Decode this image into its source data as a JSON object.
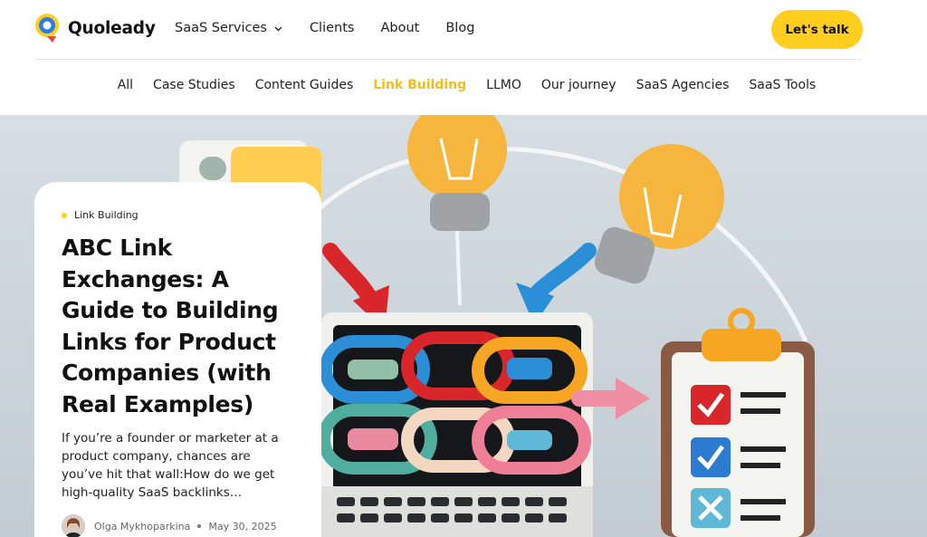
{
  "brand": {
    "name": "Quoleady",
    "accent": "#FFCE1F"
  },
  "nav": {
    "items": [
      {
        "label": "SaaS Services",
        "has_dropdown": true
      },
      {
        "label": "Clients"
      },
      {
        "label": "About"
      },
      {
        "label": "Blog"
      }
    ],
    "cta_label": "Let's talk"
  },
  "categories": {
    "items": [
      "All",
      "Case Studies",
      "Content Guides",
      "Link Building",
      "LLMO",
      "Our journey",
      "SaaS Agencies",
      "SaaS Tools"
    ],
    "active": "Link Building"
  },
  "featured_post": {
    "tag": "Link Building",
    "title": "ABC Link Exchanges: A Guide to Building Links for Product Companies (with Real Examples)",
    "excerpt": "If you’re a founder or marketer at a product company, chances are you’ve hit that wall:How do we get high-quality SaaS backlinks…",
    "author": "Olga Mykhoparkina",
    "date": "May 30, 2025"
  }
}
